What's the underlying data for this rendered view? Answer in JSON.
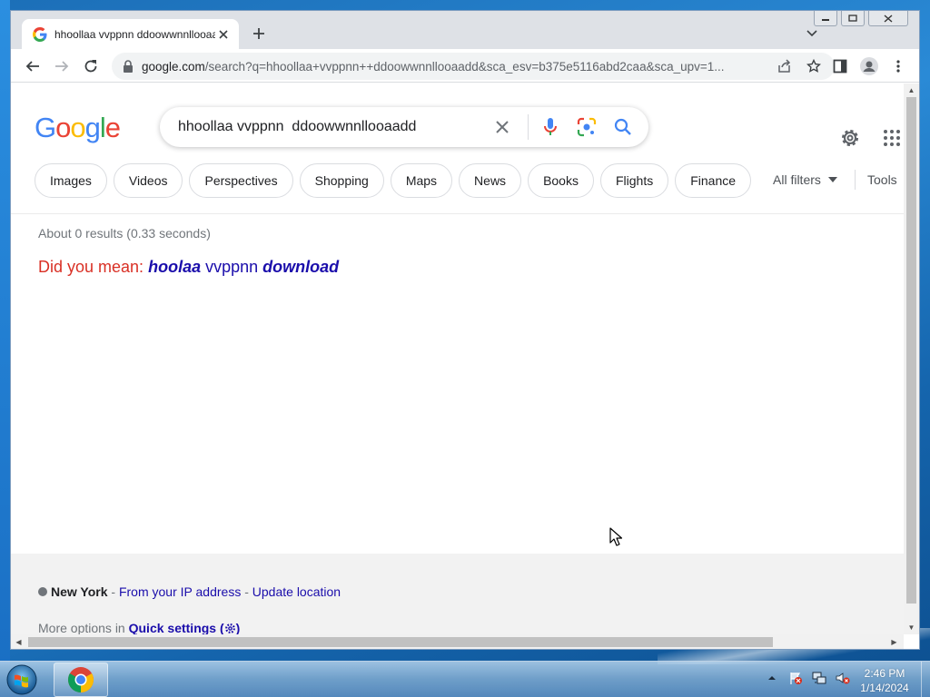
{
  "browser": {
    "tab": {
      "title": "hhoollaa vvppnn ddoowwnnllooaadd - Google Search"
    },
    "url": {
      "host": "google.com",
      "path": "/search?q=hhoollaa+vvppnn++ddoowwnnllooaadd&sca_esv=b375e5116abd2caa&sca_upv=1..."
    },
    "window_controls": [
      "minimize",
      "maximize",
      "close"
    ]
  },
  "google": {
    "logo": [
      "G",
      "o",
      "o",
      "g",
      "l",
      "e"
    ],
    "logo_colors": [
      "#4285f4",
      "#ea4335",
      "#fbbc05",
      "#4285f4",
      "#34a853",
      "#ea4335"
    ],
    "query": "hhoollaa vvppnn  ddoowwnnllooaadd",
    "chips": [
      "Images",
      "Videos",
      "Perspectives",
      "Shopping",
      "Maps",
      "News",
      "Books",
      "Flights",
      "Finance"
    ],
    "all_filters": "All filters",
    "tools": "Tools",
    "result_stats": "About 0 results (0.33 seconds)",
    "did_you_mean": {
      "label": "Did you mean:",
      "word1": "hoolaa",
      "word2": "vvppnn",
      "word3": "download"
    },
    "footer": {
      "city": "New York",
      "sep1": " - ",
      "ip_link": "From your IP address",
      "sep2": " - ",
      "update_link": "Update location",
      "more_options": "More options in ",
      "quick_settings": "Quick settings (",
      "quick_settings_end": ")"
    },
    "colors": {
      "link": "#1a0dab",
      "dym_red": "#d93025",
      "mic_blue": "#4285f4"
    }
  },
  "taskbar": {
    "pinned": [
      "chrome-icon"
    ],
    "tray": [
      "show-hidden-icons",
      "action-center-icon",
      "network-icon",
      "volume-icon"
    ],
    "time": "2:46 PM",
    "date": "1/14/2024"
  }
}
